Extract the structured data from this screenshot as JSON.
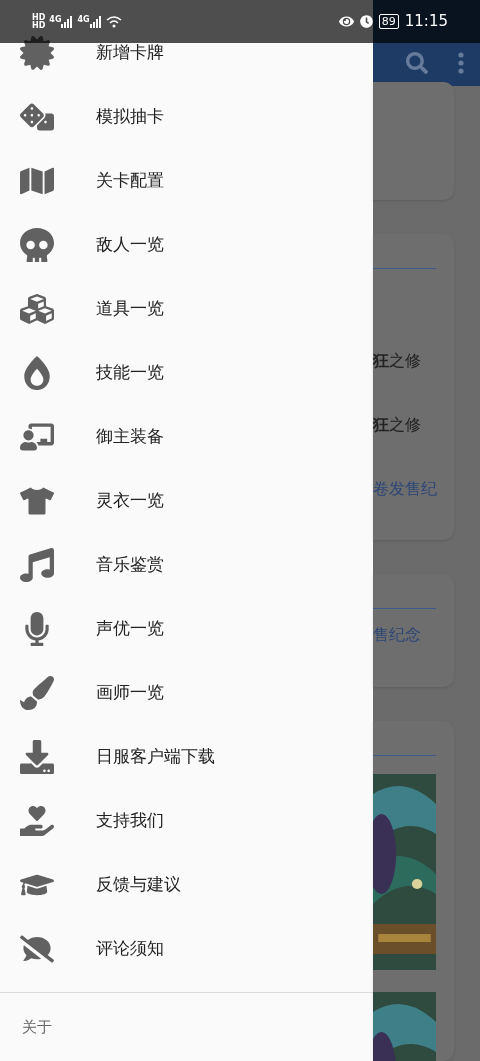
{
  "status_bar": {
    "sim_labels": [
      "HD",
      "HD"
    ],
    "network_labels": [
      "4G",
      "4G"
    ],
    "battery": "89",
    "time": "11:15"
  },
  "drawer": {
    "items": [
      {
        "label": "新增卡牌"
      },
      {
        "label": "模拟抽卡"
      },
      {
        "label": "关卡配置"
      },
      {
        "label": "敌人一览"
      },
      {
        "label": "道具一览"
      },
      {
        "label": "技能一览"
      },
      {
        "label": "御主装备"
      },
      {
        "label": "灵衣一览"
      },
      {
        "label": "音乐鉴赏"
      },
      {
        "label": "声优一览"
      },
      {
        "label": "画师一览"
      },
      {
        "label": "日服客户端下载"
      },
      {
        "label": "支持我们"
      },
      {
        "label": "反馈与建议"
      },
      {
        "label": "评论须知"
      }
    ],
    "footer": "关于"
  },
  "background_page": {
    "cards": [
      {
        "kind": "text"
      },
      {
        "kind": "text",
        "lines": [
          {
            "text": "**狂**之修",
            "kind": "plain"
          },
          {
            "text": "**狂**之修",
            "kind": "plain"
          },
          {
            "text": "卷发售纪",
            "kind": "link"
          }
        ]
      },
      {
        "kind": "text",
        "lines": [
          {
            "text": "售纪念",
            "kind": "link"
          }
        ]
      },
      {
        "kind": "pictures"
      }
    ]
  }
}
